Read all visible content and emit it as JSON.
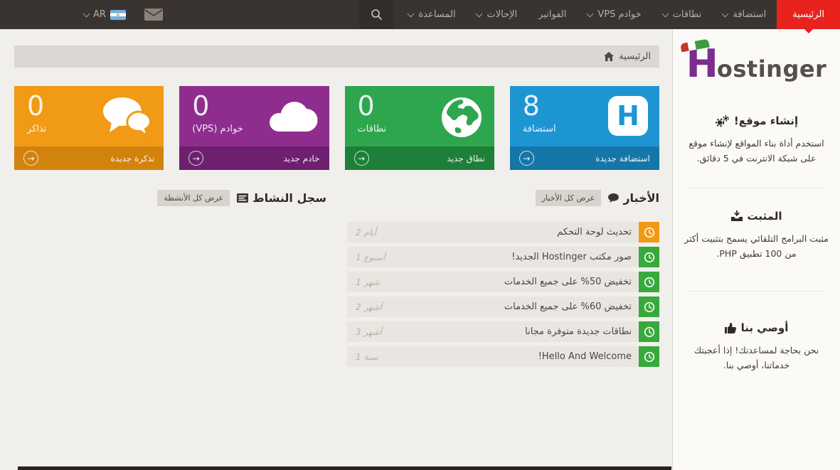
{
  "navbar": {
    "items": [
      {
        "label": "الرئيسية",
        "active": true,
        "chevron": false
      },
      {
        "label": "استضافة",
        "active": false,
        "chevron": true
      },
      {
        "label": "نطاقات",
        "active": false,
        "chevron": true
      },
      {
        "label": "خوادم VPS",
        "active": false,
        "chevron": true
      },
      {
        "label": "الفواتير",
        "active": false,
        "chevron": false
      },
      {
        "label": "الإحالات",
        "active": false,
        "chevron": true
      },
      {
        "label": "المساعدة",
        "active": false,
        "chevron": true
      }
    ],
    "language": "AR",
    "icons": {
      "search": "search-icon",
      "mail": "envelope-icon",
      "flag": "argentina-flag-icon"
    },
    "colors": {
      "bar": "#3a3430",
      "active": "#e8231d",
      "search_bg": "#332e2a"
    }
  },
  "breadcrumb": {
    "label": "الرئيسية",
    "icon": "home-icon"
  },
  "tiles": [
    {
      "count": "8",
      "label": "استضافة",
      "action": "استضافة جديدة",
      "color": "#1e95d3",
      "footer_color": "#1576a8",
      "icon": "hostinger-h-icon",
      "arrow": "→"
    },
    {
      "count": "0",
      "label": "نطاقات",
      "action": "نطاق جديد",
      "color": "#2ea64e",
      "footer_color": "#1e7f39",
      "icon": "globe-icon",
      "arrow": "→"
    },
    {
      "count": "0",
      "label": "خوادم (VPS)",
      "action": "خادم جديد",
      "color": "#8e2d8e",
      "footer_color": "#6e1f6f",
      "icon": "cloud-icon",
      "arrow": "→"
    },
    {
      "count": "0",
      "label": "تذاكر",
      "action": "تذكرة جديدة",
      "color": "#f09a15",
      "footer_color": "#d2830d",
      "icon": "chat-bubbles-icon",
      "arrow": "→"
    }
  ],
  "panels": {
    "news": {
      "title": "الأخبار",
      "icon": "comment-icon",
      "view_all": "عرض كل الأخبار",
      "items": [
        {
          "title": "تحديث لوحة التحكم",
          "date": "2 أيام",
          "badge_color": "#f09a15",
          "badge_icon": "clock-icon"
        },
        {
          "title": "صور مكتب Hostinger الجديد!",
          "date": "1 أسبوع",
          "badge_color": "#38a93c",
          "badge_icon": "clock-icon"
        },
        {
          "title": "تخفيض 50% على جميع الخدمات",
          "date": "1 شهر",
          "badge_color": "#38a93c",
          "badge_icon": "clock-icon"
        },
        {
          "title": "تخفيض 60% على جميع الخدمات",
          "date": "2 أشهر",
          "badge_color": "#38a93c",
          "badge_icon": "clock-icon"
        },
        {
          "title": "نطاقات جديدة متوفرة مجانا",
          "date": "3 أشهر",
          "badge_color": "#38a93c",
          "badge_icon": "clock-icon"
        },
        {
          "title": "Hello And Welcome!",
          "date": "1 سنة",
          "badge_color": "#38a93c",
          "badge_icon": "clock-icon"
        }
      ]
    },
    "activity": {
      "title": "سجل النشاط",
      "icon": "newspaper-icon",
      "view_all": "عرض كل الأنشطة"
    }
  },
  "sidebar": {
    "logo_h": "H",
    "logo_rest": "ostinger",
    "sections": [
      {
        "title": "إنشاء موقع!",
        "icon": "gears-icon",
        "text": "استخدم أداة بناء المواقع لإنشاء موقع على شبكة الانترنت في 5 دقائق."
      },
      {
        "title": "المثبت",
        "icon": "installer-icon",
        "text": "مثبت البرامج التلقائي يسمح بتثبيت أكثر من 100 تطبيق PHP."
      },
      {
        "title": "أوصي بنا",
        "icon": "thumbs-up-icon",
        "text": "نحن بحاجة لمساعدتك! إذا أعجبتك خدماتنا، أوصي بنا."
      }
    ]
  }
}
